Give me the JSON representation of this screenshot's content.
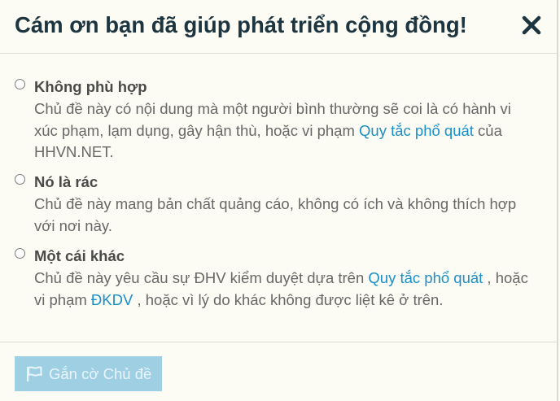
{
  "dialog": {
    "title": "Cám ơn bạn đã giúp phát triển cộng đồng!",
    "close_icon": "close-icon"
  },
  "options": [
    {
      "title": "Không phù hợp",
      "desc_before": "Chủ đề này có nội dung mà một người bình thường sẽ coi là có hành vi xúc phạm, lạm dụng, gây hận thù, hoặc vi phạm ",
      "link1": "Quy tắc phổ quát",
      "desc_after": " của HHVN.NET."
    },
    {
      "title": "Nó là rác",
      "desc": "Chủ đề này mang bản chất quảng cáo, không có ích và không thích hợp với nơi này."
    },
    {
      "title": "Một cái khác",
      "desc_before": "Chủ đề này yêu cầu sự ĐHV kiểm duyệt dựa trên ",
      "link1": "Quy tắc phổ quát",
      "desc_mid": " , hoặc vi phạm ",
      "link2": "ĐKDV",
      "desc_after": " , hoặc vì lý do khác không được liệt kê ở trên."
    }
  ],
  "footer": {
    "flag_button_label": "Gắn cờ Chủ đề",
    "flag_icon": "flag-icon"
  },
  "colors": {
    "title": "#1d3540",
    "link": "#1a8fc9",
    "button_bg": "#9fcfe3",
    "background": "#fcfbf4"
  }
}
